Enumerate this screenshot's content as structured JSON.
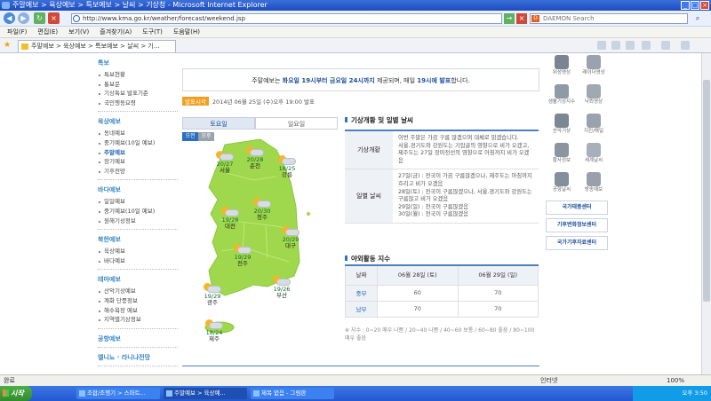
{
  "window": {
    "title": "주말예보 > 육상예보 > 특보예보 > 날씨 > 기상청 - Microsoft Internet Explorer"
  },
  "address": {
    "url": "http://www.kma.go.kr/weather/forecast/weekend.jsp",
    "search_placeholder": "DAEMON Search"
  },
  "menu": [
    "파일(F)",
    "편집(E)",
    "보기(V)",
    "즐겨찾기(A)",
    "도구(T)",
    "도움말(H)"
  ],
  "tab": {
    "label": "주말예보 > 육상예보 > 특보예보 > 날씨 > 기..."
  },
  "sidebar": {
    "sections": [
      {
        "head": "특보",
        "items": [
          "특보현황",
          "통보문",
          "기상특보 발표기준",
          "국민행동요령"
        ]
      },
      {
        "head": "육상예보",
        "items": [
          "동네예보",
          "중기예보(10일 예보)",
          "주말예보",
          "장기예보",
          "기후전망"
        ]
      },
      {
        "head": "바다예보",
        "items": [
          "일일예보",
          "중기예보(10일 예보)",
          "원해기상정보"
        ]
      },
      {
        "head": "북한예보",
        "items": [
          "육상예보",
          "바다예보"
        ]
      },
      {
        "head": "테마예보",
        "items": [
          "산악기상예보",
          "계화 단풍정보",
          "해수욕장 예보",
          "지역별기상정보"
        ]
      },
      {
        "head": "공항예보",
        "items": []
      },
      {
        "head": "엘니뇨 · 라니냐전망",
        "items": []
      }
    ],
    "active": "주말예보"
  },
  "notice": {
    "pre": "주말예보는 ",
    "b1": "화요일 19시부터 금요일 24시까지",
    "mid": " 제공되며, 매일 ",
    "b2": "19시에 발표",
    "post": "합니다."
  },
  "issued": {
    "label": "발표시각",
    "text": "2014년 06월 25일 (수)오후 19:00 발표"
  },
  "day_tabs": {
    "sat": "토요일",
    "sun": "일요일"
  },
  "ampm": {
    "am": "오전",
    "pm": "오후"
  },
  "cities": [
    {
      "name": "서울",
      "temp": "20/27"
    },
    {
      "name": "춘천",
      "temp": "20/28"
    },
    {
      "name": "강릉",
      "temp": "18/25"
    },
    {
      "name": "청주",
      "temp": "20/30"
    },
    {
      "name": "대전",
      "temp": "19/28"
    },
    {
      "name": "대구",
      "temp": "20/29"
    },
    {
      "name": "전주",
      "temp": "19/29"
    },
    {
      "name": "광주",
      "temp": "19/29"
    },
    {
      "name": "부산",
      "temp": "19/26"
    },
    {
      "name": "제주",
      "temp": "18/24"
    }
  ],
  "conditions": {
    "title": "기상개황 및 일별 날씨",
    "rows": [
      {
        "h": "기상개황",
        "lines": [
          "이번 주말은 가끔 구름 많겠으며 대체로 맑겠습니다.",
          "서울.경기도와 강원도는 기압골의 영향으로 비가 오겠고, 제주도는 27일 장마전선의 영향으로 아침까지 비가 오겠음"
        ]
      },
      {
        "h": "일별 날씨",
        "lines": [
          "27일(금) : 전국이 가끔 구름많겠으나, 제주도는 아침까지 흐리고 비가 오겠음",
          "28일(토) : 전국이 구름많겠으나, 서울.경기도와 강원도는 구름많고 비가 오겠음",
          "29일(일) : 전국이 구름많겠음",
          "30일(월) : 전국이 구름많겠음"
        ]
      }
    ]
  },
  "index": {
    "title": "야외활동 지수",
    "col_head": "날짜",
    "cols": [
      "06월 28일 (토)",
      "06월 29일 (일)"
    ],
    "rows": [
      {
        "region": "중부",
        "values": [
          "60",
          "70"
        ]
      },
      {
        "region": "남부",
        "values": [
          "70",
          "70"
        ]
      }
    ],
    "note": "※ 지수 : 0~20 매우 나쁨 / 20~40 나쁨 / 40~60 보통 / 60~80 좋음 / 80~100 매우 좋음"
  },
  "quick": [
    "위성영상",
    "레이더영상",
    "생활기상지수",
    "낙뢰영상",
    "산악기상",
    "지진/해일",
    "황사정보",
    "세계날씨",
    "공항날씨",
    "방송예보"
  ],
  "banners": [
    "국가태풍센터",
    "기후변화정보센터",
    "국가기후자료센터"
  ],
  "status": {
    "left": "완료",
    "zone": "인터넷",
    "zoom": "100%"
  },
  "taskbar": {
    "start": "시작",
    "items": [
      "조합/조행기 > 스마트...",
      "주말예보 > 육상예...",
      "제목 없음 - 그림판"
    ],
    "clock": "오후 3:50"
  }
}
